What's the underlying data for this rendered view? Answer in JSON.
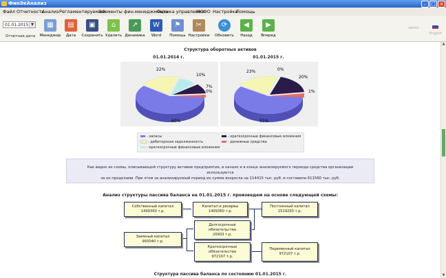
{
  "window": {
    "title": "ФинЭкАнализ"
  },
  "menu": [
    "Файл",
    "Отчетность",
    "Анализ",
    "Регламентируемый",
    "Элементы фин.менеджмента",
    "Оценка управления",
    "МСФО",
    "Настройки",
    "Помощь"
  ],
  "toolbar": {
    "date_value": "01.01.2015",
    "date_label": "Отчетная дата",
    "buttons": [
      {
        "label": "Менеджер",
        "icon": "manager-icon"
      },
      {
        "label": "Дата",
        "icon": "calendar-icon"
      },
      {
        "label": "Сохранить",
        "icon": "save-icon"
      },
      {
        "label": "Удалить",
        "icon": "delete-icon"
      },
      {
        "label": "Динамика",
        "icon": "dynamics-icon"
      },
      {
        "label": "Word",
        "icon": "word-icon"
      },
      {
        "label": "Помощь",
        "icon": "help-icon"
      },
      {
        "label": "Настройки",
        "icon": "settings-icon"
      },
      {
        "label": "Обновить",
        "icon": "refresh-icon"
      },
      {
        "label": "Назад",
        "icon": "back-arrow-icon"
      },
      {
        "label": "Вперед",
        "icon": "forward-arrow-icon"
      }
    ],
    "user": "admin",
    "lang": "English"
  },
  "assets_section": {
    "title": "Структура оборотных активов",
    "colors": {
      "inventory": "#7b7be8",
      "receivables": "#f6f6b4",
      "short_fin": "#b8ecec",
      "cash": "#e66b6b",
      "dark": "#2a1b4a"
    }
  },
  "chart_data": [
    {
      "type": "pie",
      "title": "01.01.2014 г.",
      "categories": [
        "запасы",
        "дебиторская задолженность",
        "краткосрочные финансовые вложения",
        "краткосрочные финансовые вложения (2)",
        "денежные средства"
      ],
      "values": [
        60,
        22,
        10,
        7,
        0
      ],
      "labels": [
        "60%",
        "22%",
        "10%",
        "7%",
        "0%"
      ]
    },
    {
      "type": "pie",
      "title": "01.01.2015 г.",
      "categories": [
        "запасы",
        "дебиторская задолженность",
        "краткосрочные финансовые вложения",
        "краткосрочные финансовые вложения (2)",
        "денежные средства"
      ],
      "values": [
        55,
        23,
        0,
        20,
        1
      ],
      "labels": [
        "55%",
        "23%",
        "0%",
        "20%",
        "1%"
      ]
    }
  ],
  "legend": [
    "- запасы",
    "- дебиторская задолженность",
    "- краткосрочные финансовые вложения",
    "- краткосрочные финансовые вложения",
    "- денежные средства"
  ],
  "note": {
    "line1": "Как видно из схемы, описывающей структуру активов предприятия, в начале и в конце анализируемого периода средства организации используются",
    "line2": "за ее пределами. При этом за анализируемый период их сумма возросла на 114415 тыс. руб. и составила 611560 тыс. руб."
  },
  "liabilities": {
    "title": "Анализ структуры пассива баланса на 01.01.2015 г. произведем на основе следующей схемы:",
    "boxes": {
      "equity": {
        "l1": "Собственный капитал",
        "l2": "1499360 т.р."
      },
      "capital": {
        "l1": "Капитал и резервы",
        "l2": "1499360 т.р."
      },
      "permanent": {
        "l1": "Постоянный капитал",
        "l2": "1519293 т.р."
      },
      "longterm": {
        "l1": "Долгосрочные",
        "l2": "обязательства",
        "l3": "20933 т.р."
      },
      "borrowed": {
        "l1": "Заемный капитал",
        "l2": "993040 т.р."
      },
      "shortterm": {
        "l1": "Краткосрочные",
        "l2": "обязательства",
        "l3": "972107 т.р."
      },
      "variable": {
        "l1": "Переменный капитал",
        "l2": "972107 т.р."
      }
    }
  },
  "bottom_title": "Структура пассива баланса по состоянию 01.01.2015 г."
}
